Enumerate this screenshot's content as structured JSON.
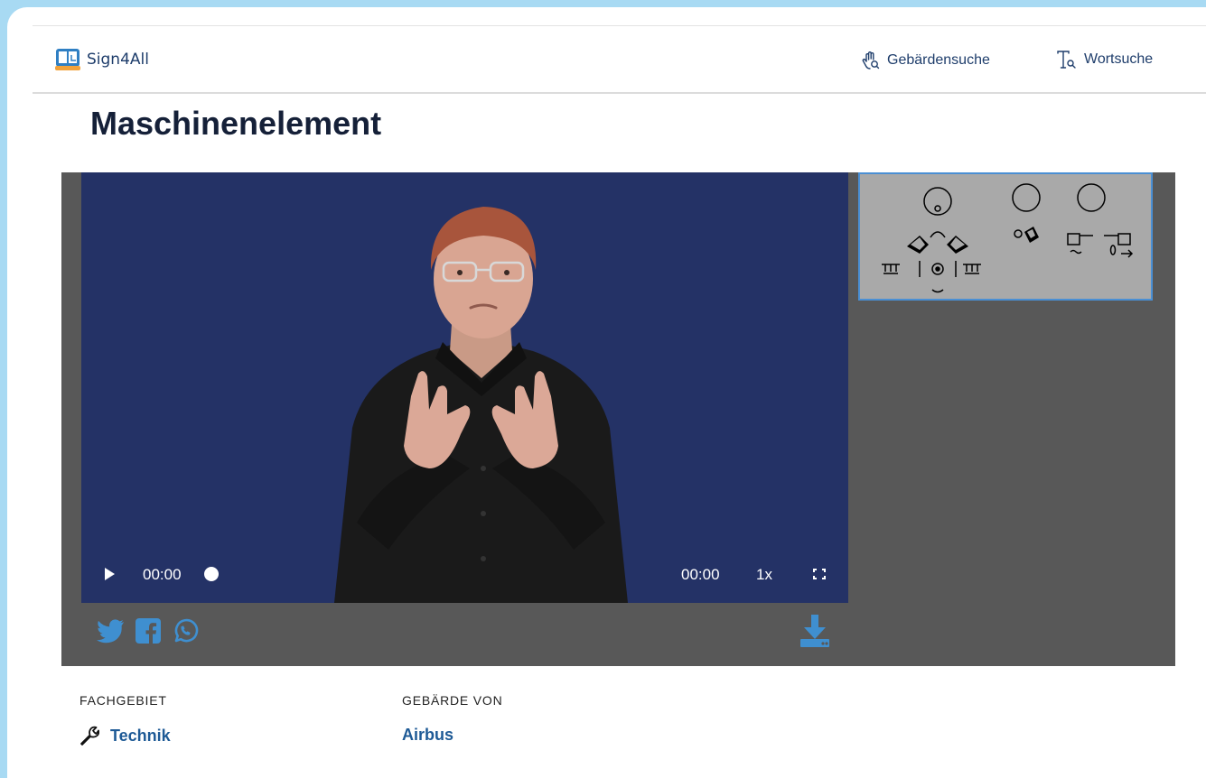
{
  "app": {
    "brand": "Sign4All"
  },
  "nav": {
    "sign_search": {
      "label": "Gebärdensuche",
      "icon": "hand-search-icon"
    },
    "word_search": {
      "label": "Wortsuche",
      "icon": "text-search-icon"
    }
  },
  "page": {
    "title": "Maschinenelement"
  },
  "player": {
    "current_time": "00:00",
    "total_time": "00:00",
    "speed": "1x",
    "progress": 0
  },
  "share": {
    "icons": [
      "twitter-icon",
      "facebook-icon",
      "whatsapp-icon"
    ],
    "download_icon": "download-icon"
  },
  "details": {
    "field_label": "FACHGEBIET",
    "field_value": "Technik",
    "field_icon": "wrench-icon",
    "author_label": "GEBÄRDE VON",
    "author_value": "Airbus"
  },
  "colors": {
    "background": "#a8daf3",
    "brand": "#1e3d6b",
    "link": "#1e5a96",
    "video_bg": "#243266",
    "panel": "#585858",
    "share_icons": "#3f8fd0",
    "notation_border": "#4a8fd4"
  }
}
